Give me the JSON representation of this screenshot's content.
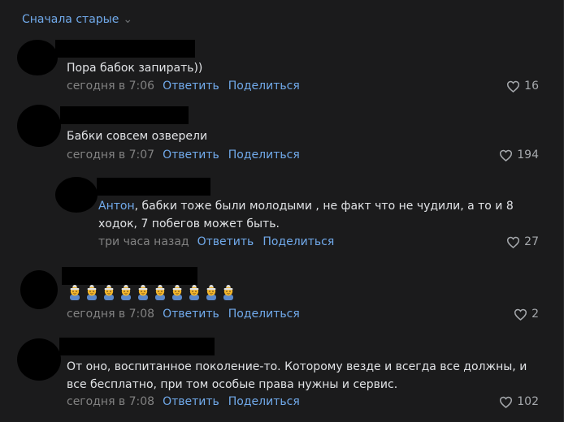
{
  "sort_label": "Сначала старые",
  "actions": {
    "reply": "Ответить",
    "share": "Поделиться"
  },
  "comments": [
    {
      "text": "Пора бабок запирать))",
      "time": "сегодня в 7:06",
      "likes": "16"
    },
    {
      "text": "Бабки совсем озверели",
      "time": "сегодня в 7:07",
      "likes": "194"
    },
    {
      "mention": "Антон",
      "text_line1": ", бабки тоже были молодыми , не факт что не чудили, а то и 8",
      "text_line2": "ходок, 7 побегов может быть.",
      "time": "три часа назад",
      "likes": "27"
    },
    {
      "emoji": "old-woman-emoji",
      "emoji_count": 10,
      "time": "сегодня в 7:08",
      "likes": "2"
    },
    {
      "text_line1": "От оно, воспитанное поколение-то. Которому везде и всегда все должны, и",
      "text_line2": "все бесплатно, при том особые права нужны и сервис.",
      "time": "сегодня в 7:08",
      "likes": "102"
    }
  ]
}
